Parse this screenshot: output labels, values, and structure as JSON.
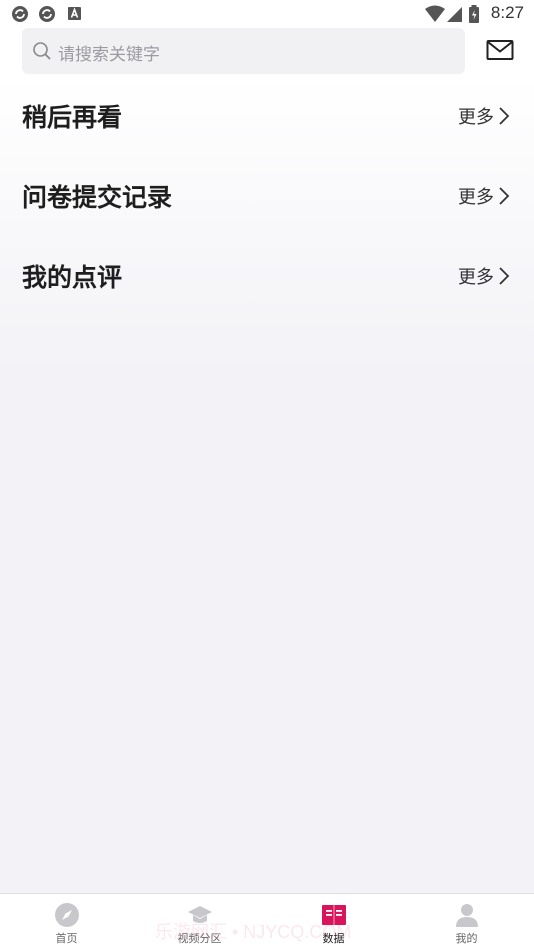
{
  "status_bar": {
    "time": "8:27",
    "left_icons": [
      "sync-icon",
      "sync-icon",
      "a-badge-icon"
    ],
    "right_icons": [
      "wifi-icon",
      "signal-icon",
      "battery-icon"
    ]
  },
  "header": {
    "search_placeholder": "请搜索关键字",
    "mail_icon": "mail-icon"
  },
  "sections": [
    {
      "title": "稍后再看",
      "more": "更多"
    },
    {
      "title": "问卷提交记录",
      "more": "更多"
    },
    {
      "title": "我的点评",
      "more": "更多"
    }
  ],
  "bottom_nav": {
    "items": [
      {
        "label": "首页",
        "icon": "compass-icon",
        "active": false
      },
      {
        "label": "视频分区",
        "icon": "graduation-cap-icon",
        "active": false
      },
      {
        "label": "数据",
        "icon": "book-icon",
        "active": true
      },
      {
        "label": "我的",
        "icon": "user-icon",
        "active": false
      }
    ],
    "active_color": "#d8145c",
    "inactive_color": "#c8c8cc"
  },
  "watermark": "乐游网汇 • NJYCQ.COM"
}
